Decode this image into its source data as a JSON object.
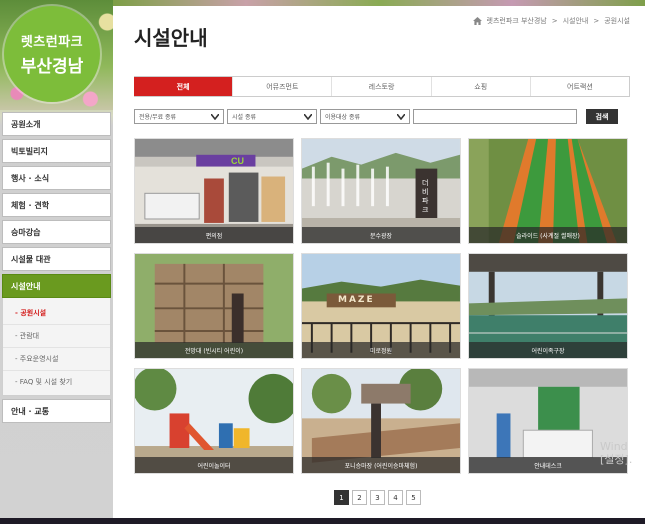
{
  "sidebar": {
    "logo": {
      "line1": "렛츠런파크",
      "line2": "부산경남"
    },
    "menu": [
      {
        "label": "공원소개"
      },
      {
        "label": "빅토빌리지"
      },
      {
        "label": "행사 · 소식"
      },
      {
        "label": "체험 · 견학"
      },
      {
        "label": "승마강습"
      },
      {
        "label": "시설물 대관"
      },
      {
        "label": "시설안내"
      },
      {
        "label": "안내 · 교통"
      }
    ],
    "submenu": [
      {
        "label": "공원시설"
      },
      {
        "label": "관람대"
      },
      {
        "label": "주요운영시설"
      },
      {
        "label": "FAQ 및 시설 찾기"
      }
    ]
  },
  "header": {
    "title": "시설안내",
    "breadcrumb": [
      "첫 화면",
      "렛츠런파크 부산경남",
      "시설안내",
      "공원시설"
    ]
  },
  "tabs": [
    {
      "label": "전체"
    },
    {
      "label": "어뮤즈먼트"
    },
    {
      "label": "레스토랑"
    },
    {
      "label": "쇼핑"
    },
    {
      "label": "어트랙션"
    }
  ],
  "filters": {
    "sel1": "전용/무료 종류",
    "sel2": "시설 종류",
    "sel3": "이용대상 종류",
    "search_button": "검색"
  },
  "cards": [
    {
      "caption": "편의점"
    },
    {
      "caption": "분수광장"
    },
    {
      "caption": "슬라이드 (사계절 썰매장)"
    },
    {
      "caption": "전망대 (빈시티 어린이)"
    },
    {
      "caption": "미로정원"
    },
    {
      "caption": "어린이족구장"
    },
    {
      "caption": "어린이놀이터"
    },
    {
      "caption": "포니승마장 (어린이승마체험)"
    },
    {
      "caption": "안내데스크"
    }
  ],
  "sign_text": "더비파크",
  "maze_text": "MAZE",
  "store_sign": "CU",
  "pagination": [
    "1",
    "2",
    "3",
    "4",
    "5"
  ],
  "watermark": {
    "line1": "Wind",
    "line2": "[설정]."
  },
  "colors": {
    "accent": "#d4201f",
    "sidebar_active": "#6a9a1f",
    "logo": "#7dbd3a"
  }
}
